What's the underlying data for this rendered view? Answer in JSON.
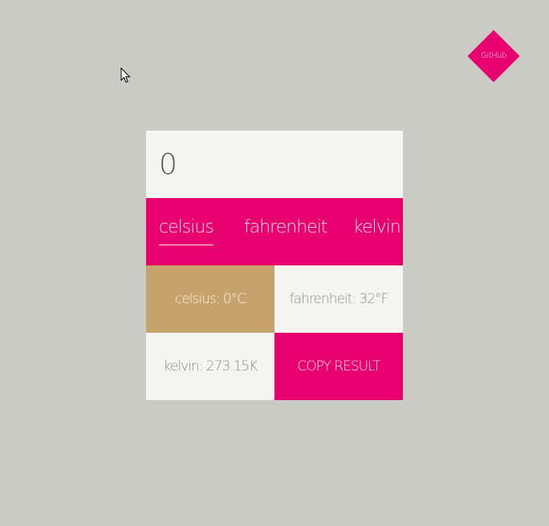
{
  "github": {
    "label": "GitHub"
  },
  "converter": {
    "input_value": "0",
    "units": [
      {
        "label": "celsius",
        "active": true
      },
      {
        "label": "fahrenheit",
        "active": false
      },
      {
        "label": "kelvin",
        "active": false
      }
    ],
    "results": {
      "celsius": "celsius: 0°C",
      "fahrenheit": "fahrenheit: 32°F",
      "kelvin": "kelvin: 273.15K"
    },
    "copy_label": "COPY RESULT"
  },
  "colors": {
    "background": "#cbcbc6",
    "accent": "#e8006f",
    "highlight": "#c6a26c",
    "panel": "#f4f4f0"
  }
}
